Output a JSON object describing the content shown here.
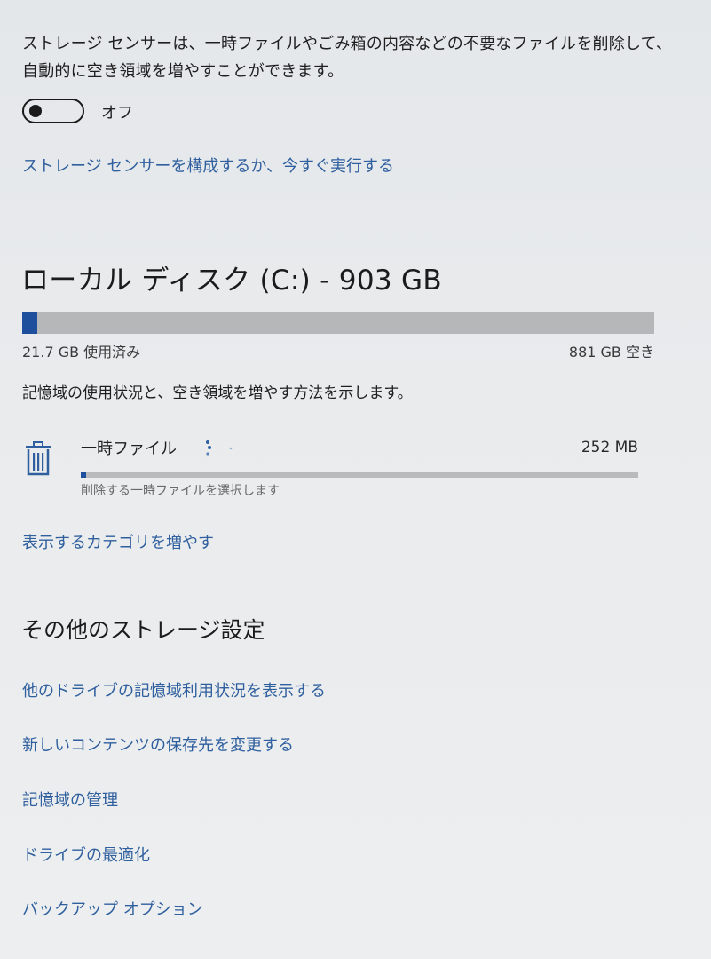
{
  "storage_sense": {
    "description": "ストレージ センサーは、一時ファイルやごみ箱の内容などの不要なファイルを削除して、自動的に空き領域を増やすことができます。",
    "toggle_state": "オフ",
    "toggle_on": false,
    "configure_link": "ストレージ センサーを構成するか、今すぐ実行する"
  },
  "disk": {
    "title": "ローカル ディスク (C:) - 903 GB",
    "used_label": "21.7 GB 使用済み",
    "free_label": "881 GB 空き",
    "used_fraction": 0.024,
    "info": "記憶域の使用状況と、空き領域を増やす方法を示します。"
  },
  "categories": [
    {
      "name": "一時ファイル",
      "size": "252 MB",
      "subtitle": "削除する一時ファイルを選択します",
      "icon": "trash-icon",
      "fraction": 0.01
    }
  ],
  "show_more_link": "表示するカテゴリを増やす",
  "other_settings": {
    "heading": "その他のストレージ設定",
    "links": [
      "他のドライブの記憶域利用状況を表示する",
      "新しいコンテンツの保存先を変更する",
      "記憶域の管理",
      "ドライブの最適化",
      "バックアップ オプション"
    ]
  },
  "colors": {
    "accent": "#1e4f9c",
    "link": "#2f5f9e",
    "bar_track": "#b6b7b9"
  }
}
